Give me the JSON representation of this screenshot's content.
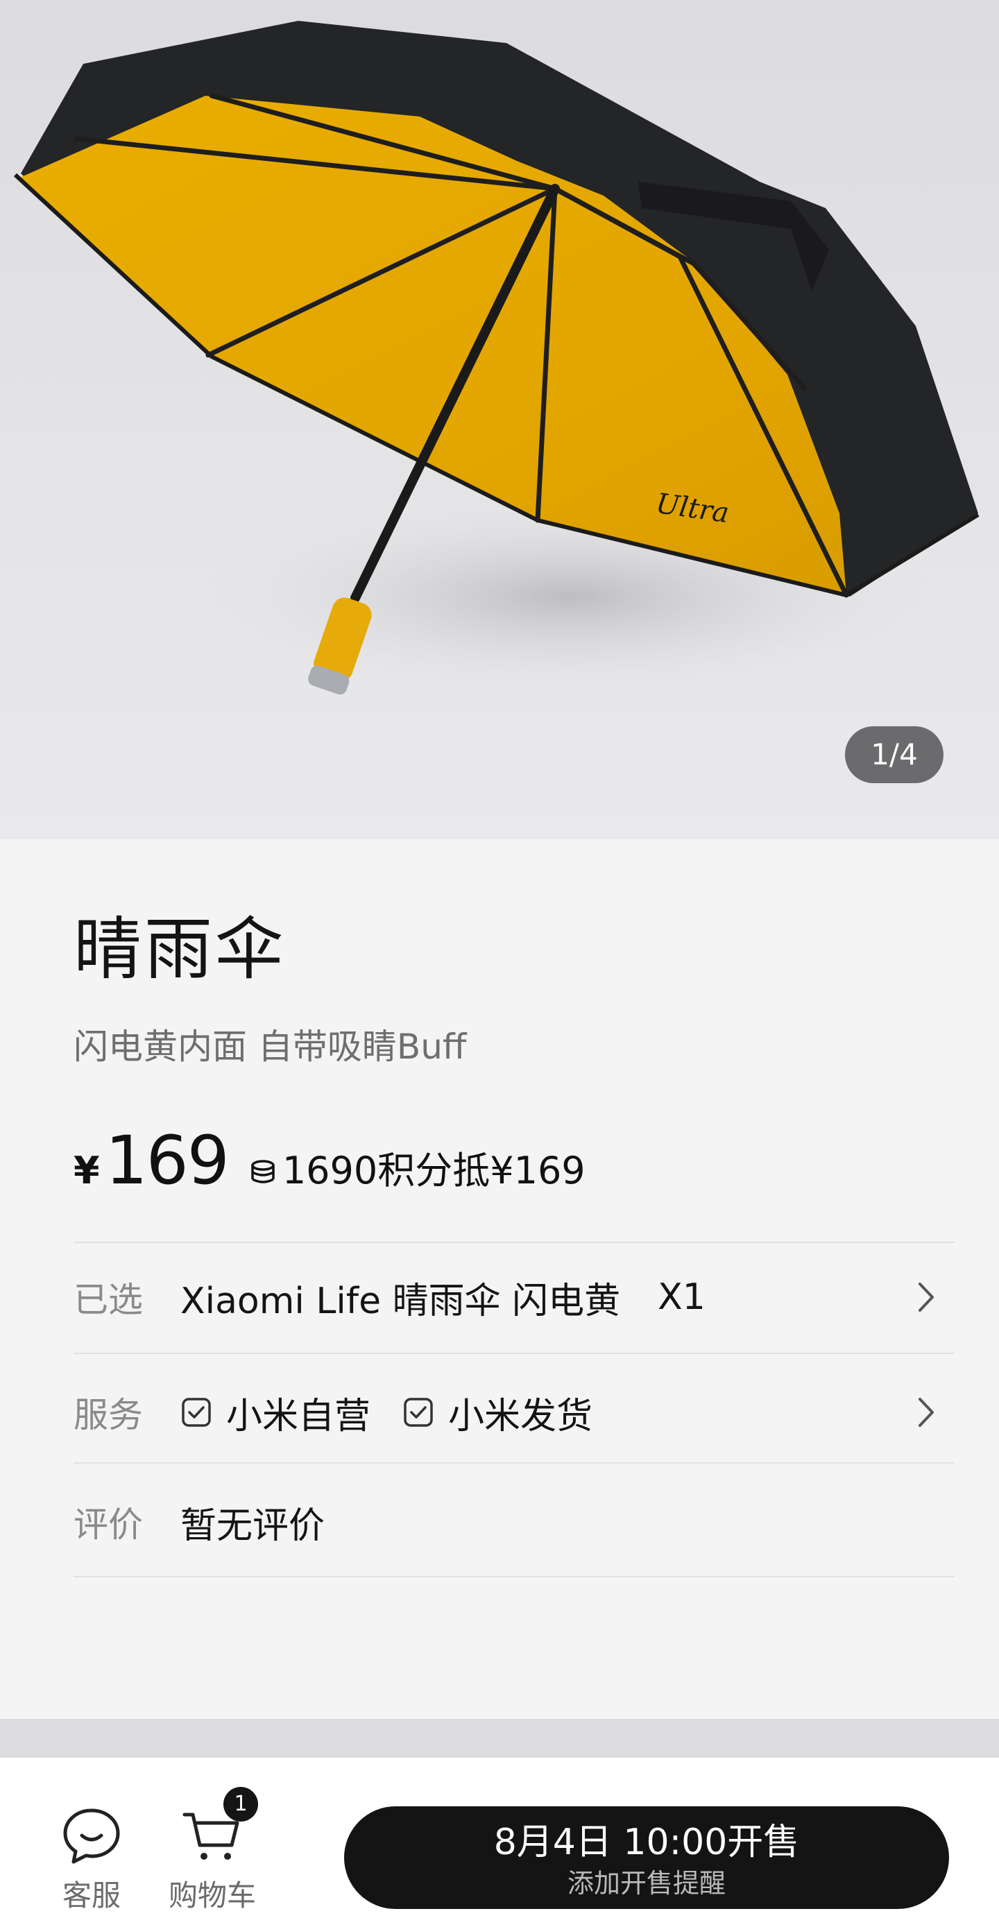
{
  "gallery": {
    "image_logo": "Ultra",
    "page_indicator": "1/4"
  },
  "product": {
    "title": "晴雨伞",
    "subtitle": "闪电黄内面 自带吸睛Buff",
    "currency": "¥",
    "price": "169",
    "points_text": "1690积分抵¥169"
  },
  "selected": {
    "label": "已选",
    "value": "Xiaomi Life 晴雨伞 闪电黄",
    "qty": "X1"
  },
  "service": {
    "label": "服务",
    "items": [
      "小米自营",
      "小米发货"
    ]
  },
  "review": {
    "label": "评价",
    "value": "暂无评价"
  },
  "bottom_bar": {
    "customer_service_label": "客服",
    "cart_label": "购物车",
    "cart_badge": "1",
    "cta_main": "8月4日 10:00开售",
    "cta_sub": "添加开售提醒"
  },
  "colors": {
    "canopy_inner": "#E2A600",
    "canopy_outer": "#232527",
    "cta_background": "#141414"
  },
  "icons": [
    "chat-bubble-icon",
    "cart-icon",
    "check-square-icon",
    "chevron-right-icon",
    "coin-stack-icon"
  ]
}
